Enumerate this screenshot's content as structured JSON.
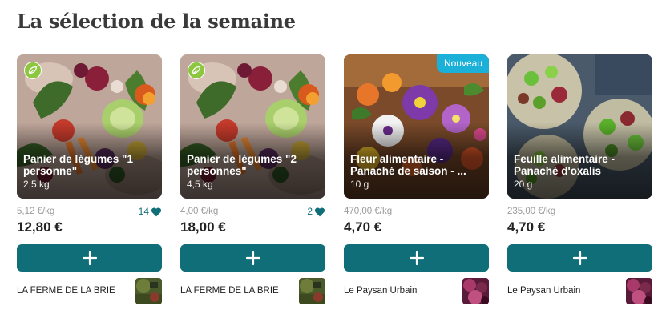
{
  "section": {
    "title": "La sélection de la semaine"
  },
  "products": [
    {
      "name": "Panier de légumes \"1 personne\"",
      "weight": "2,5 kg",
      "unit_price": "5,12 €/kg",
      "price": "12,80 €",
      "likes": "14",
      "producer": "LA FERME DE LA BRIE",
      "badge": "bio",
      "image_icon": "vegetable-basket"
    },
    {
      "name": "Panier de légumes \"2 personnes\"",
      "weight": "4,5 kg",
      "unit_price": "4,00 €/kg",
      "price": "18,00 €",
      "likes": "2",
      "producer": "LA FERME DE LA BRIE",
      "badge": "bio",
      "image_icon": "vegetable-basket"
    },
    {
      "name": "Fleur alimentaire - Panaché de saison - ...",
      "weight": "10 g",
      "unit_price": "470,00 €/kg",
      "price": "4,70 €",
      "badge_label": "Nouveau",
      "producer": "Le Paysan Urbain",
      "image_icon": "edible-flowers"
    },
    {
      "name": "Feuille alimentaire - Panaché d'oxalis",
      "weight": "20 g",
      "unit_price": "235,00 €/kg",
      "price": "4,70 €",
      "producer": "Le Paysan Urbain",
      "image_icon": "oxalis-leaves"
    }
  ],
  "colors": {
    "accent": "#0f6e78",
    "new_badge": "#1ab0d8",
    "bio_badge": "#8dc63f"
  }
}
